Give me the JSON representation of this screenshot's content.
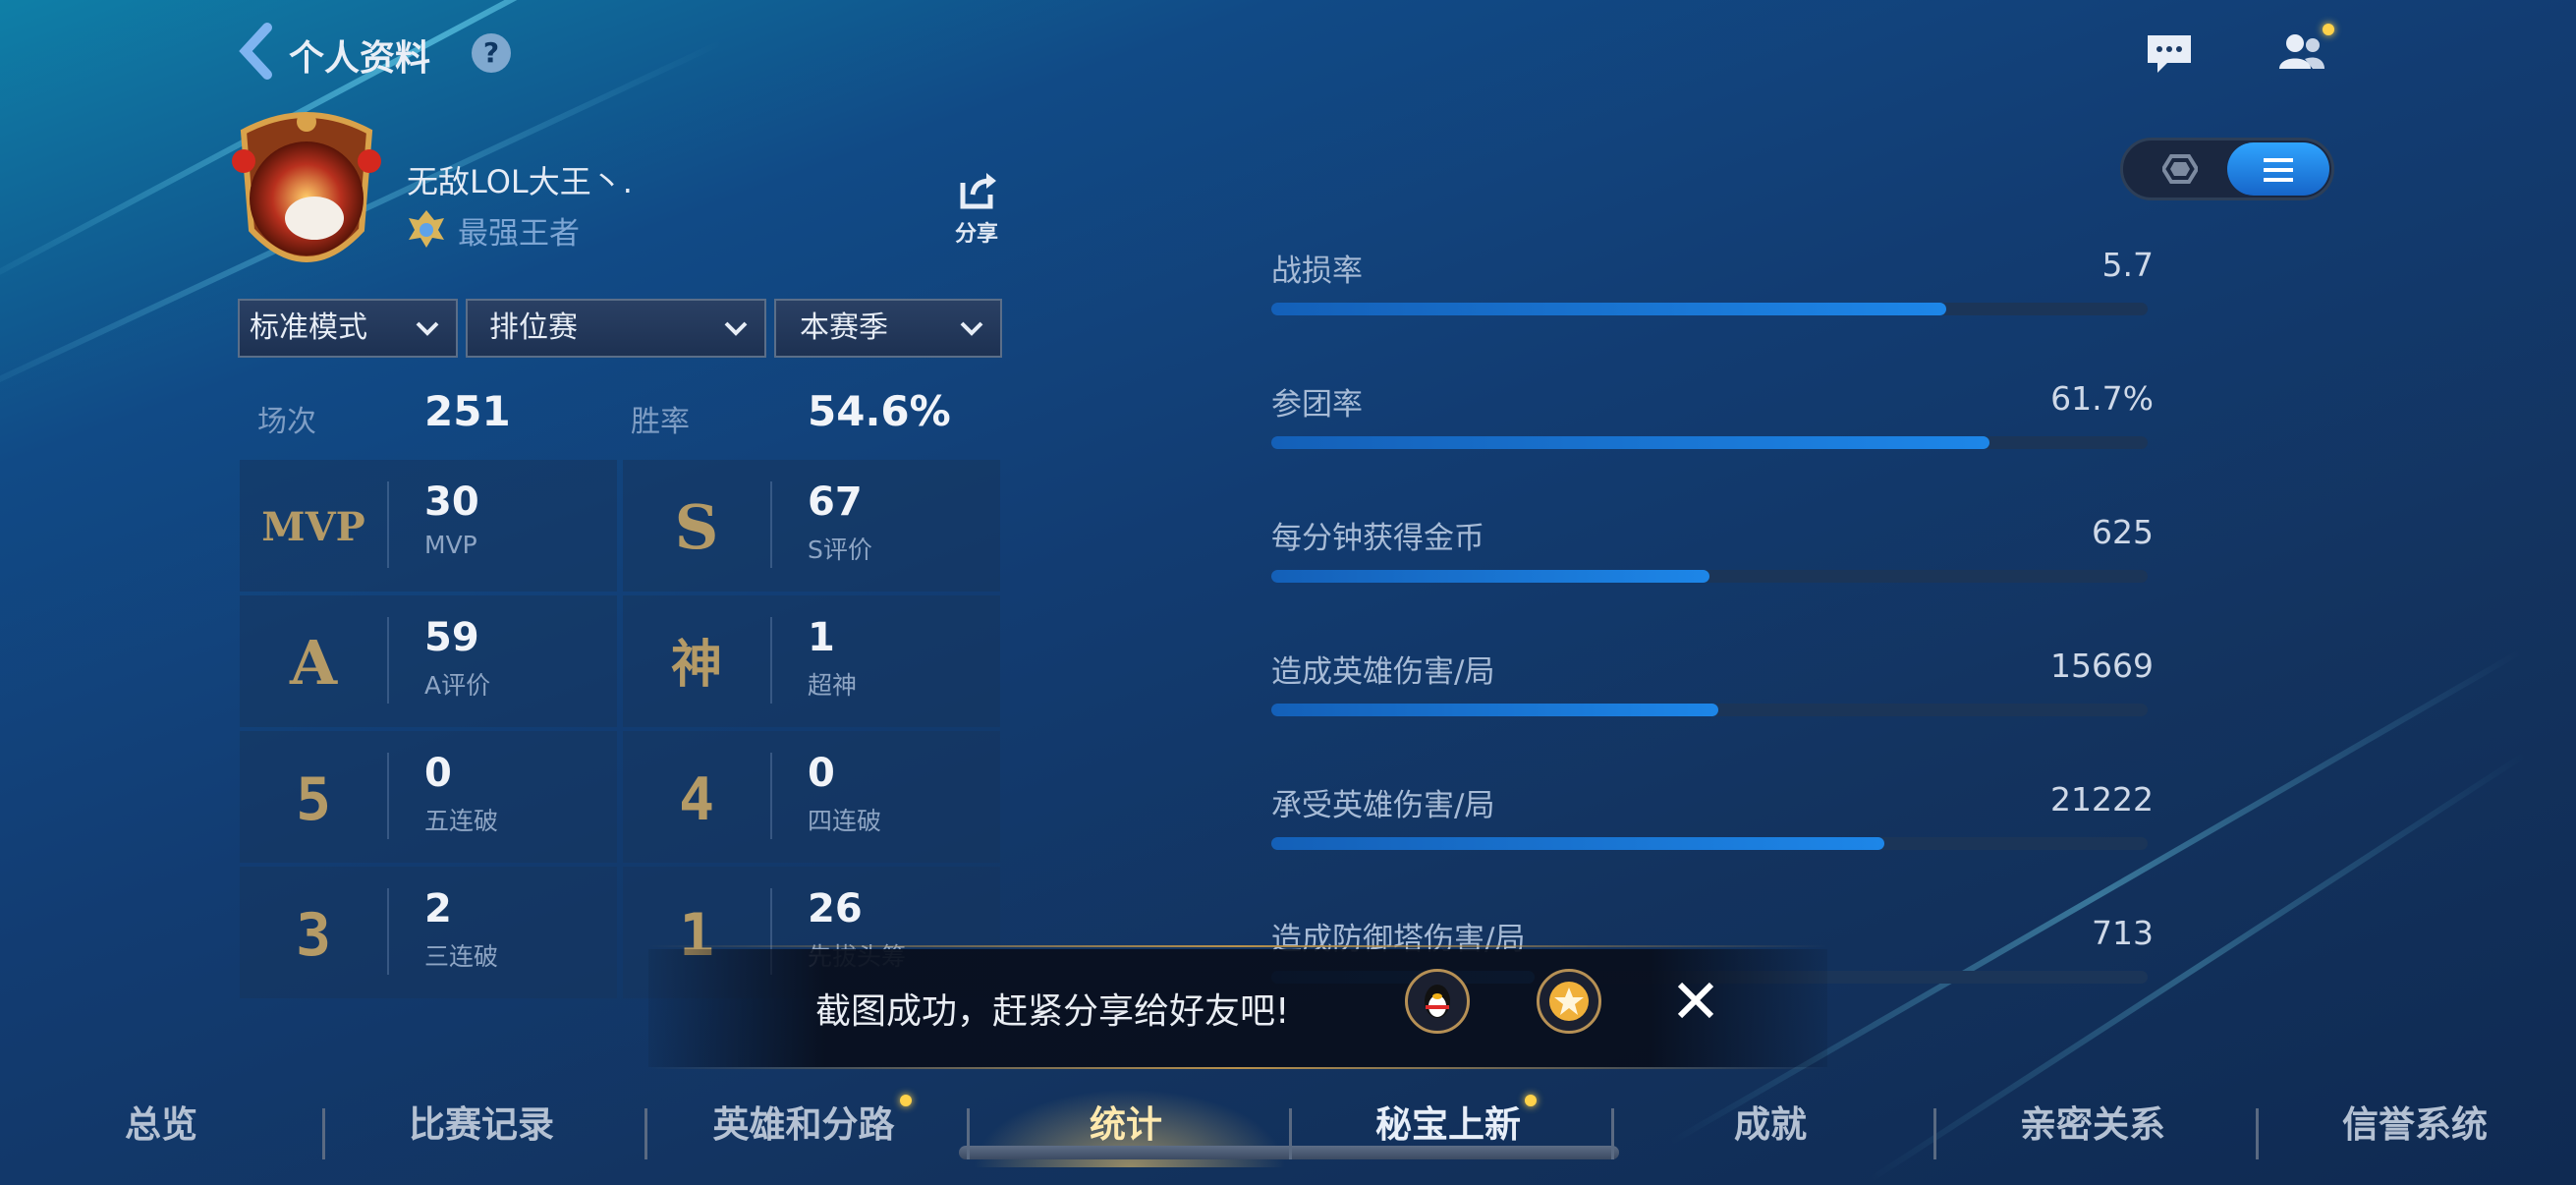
{
  "header": {
    "title": "个人资料",
    "help_label": "?"
  },
  "profile": {
    "name": "无敌LOL大王丶.",
    "rank": "最强王者",
    "share_label": "分享"
  },
  "filters": {
    "mode": "标准模式",
    "queue": "排位赛",
    "season": "本赛季"
  },
  "summary": {
    "games_label": "场次",
    "games_value": "251",
    "winrate_label": "胜率",
    "winrate_value": "54.6%"
  },
  "achievements": [
    {
      "emblem": "MVP",
      "value": "30",
      "label": "MVP"
    },
    {
      "emblem": "S",
      "value": "67",
      "label": "S评价"
    },
    {
      "emblem": "A",
      "value": "59",
      "label": "A评价"
    },
    {
      "emblem": "神",
      "value": "1",
      "label": "超神"
    },
    {
      "emblem": "5",
      "value": "0",
      "label": "五连破"
    },
    {
      "emblem": "4",
      "value": "0",
      "label": "四连破"
    },
    {
      "emblem": "3",
      "value": "2",
      "label": "三连破"
    },
    {
      "emblem": "1",
      "value": "26",
      "label": "先拔头筹"
    }
  ],
  "stats": [
    {
      "label": "战损率",
      "value": "5.7",
      "fill": 0.77
    },
    {
      "label": "参团率",
      "value": "61.7%",
      "fill": 0.82
    },
    {
      "label": "每分钟获得金币",
      "value": "625",
      "fill": 0.5
    },
    {
      "label": "造成英雄伤害/局",
      "value": "15669",
      "fill": 0.51
    },
    {
      "label": "承受英雄伤害/局",
      "value": "21222",
      "fill": 0.7
    },
    {
      "label": "造成防御塔伤害/局",
      "value": "713",
      "fill": 0.3
    }
  ],
  "toast": {
    "message": "截图成功，赶紧分享给好友吧!"
  },
  "nav": {
    "tabs": [
      "总览",
      "比赛记录",
      "英雄和分路",
      "统计",
      "秘宝上新",
      "成就",
      "亲密关系",
      "信誉系统"
    ],
    "active": "统计"
  },
  "watermark_id": "6396318",
  "colors": {
    "accent_blue": "#1d86e8",
    "gold": "#b8914c",
    "notify_dot": "#ffd24a"
  }
}
